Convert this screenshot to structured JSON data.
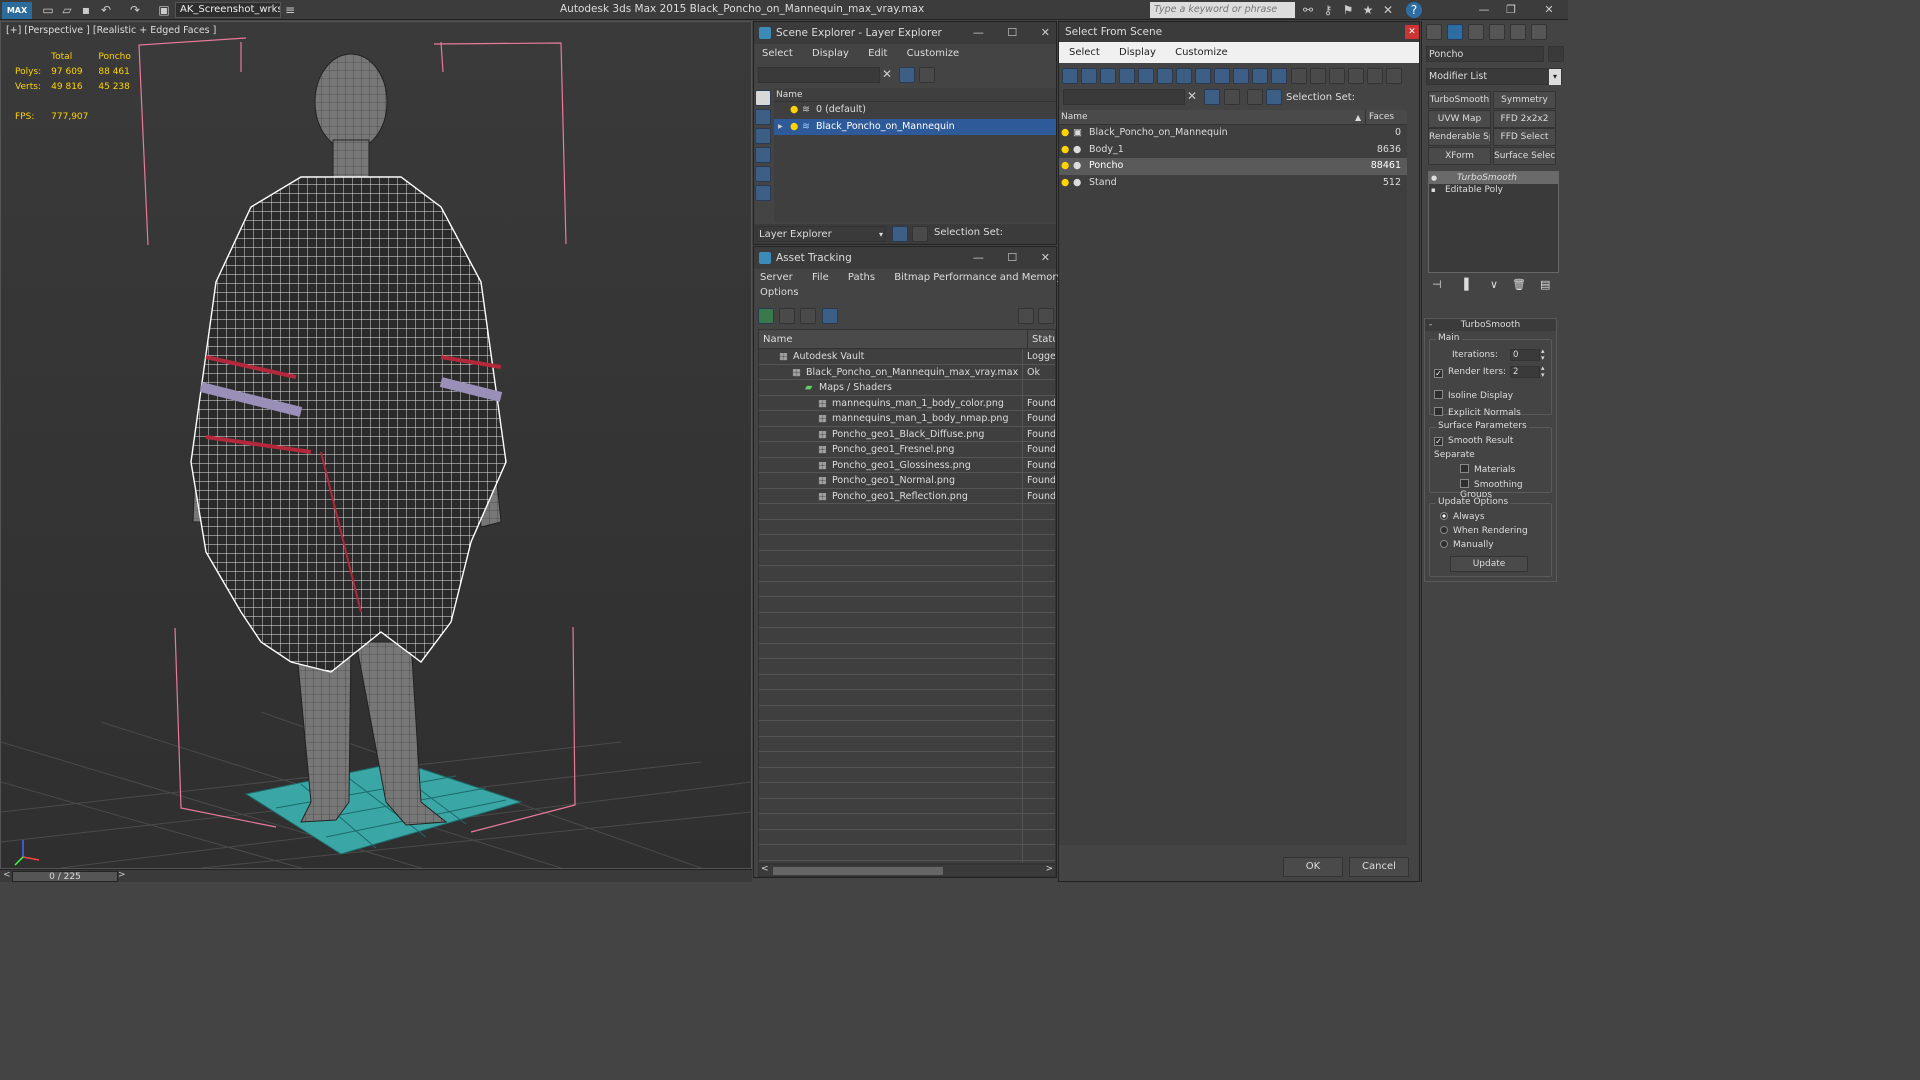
{
  "app": {
    "title": "Autodesk 3ds Max  2015    Black_Poncho_on_Mannequin_max_vray.max",
    "workspace": "AK_Screenshot_wrksp",
    "search_placeholder": "Type a keyword or phrase",
    "logo": "MAX"
  },
  "viewport": {
    "label": "[+] [Perspective ] [Realistic + Edged Faces ]",
    "stats": {
      "col_total": "Total",
      "col_sel": "Poncho",
      "polys_label": "Polys:",
      "polys_total": "97 609",
      "polys_sel": "88 461",
      "verts_label": "Verts:",
      "verts_total": "49 816",
      "verts_sel": "45 238",
      "fps_label": "FPS:",
      "fps_value": "777,907"
    }
  },
  "timeline": {
    "frame": "0 / 225"
  },
  "scene_explorer": {
    "title": "Scene Explorer - Layer Explorer",
    "menu": [
      "Select",
      "Display",
      "Edit",
      "Customize"
    ],
    "col_name": "Name",
    "rows": [
      "0 (default)",
      "Black_Poncho_on_Mannequin"
    ],
    "footer_label": "Layer Explorer",
    "selection_set": "Selection Set:"
  },
  "asset_tracking": {
    "title": "Asset Tracking",
    "menu": [
      "Server",
      "File",
      "Paths",
      "Bitmap Performance and Memory"
    ],
    "menu2": "Options",
    "col_name": "Name",
    "col_status": "Status",
    "rows": [
      {
        "name": "Autodesk Vault",
        "status": "Logged",
        "indent": 0
      },
      {
        "name": "Black_Poncho_on_Mannequin_max_vray.max",
        "status": "Ok",
        "indent": 1
      },
      {
        "name": "Maps / Shaders",
        "status": "",
        "indent": 2
      },
      {
        "name": "mannequins_man_1_body_color.png",
        "status": "Found",
        "indent": 3
      },
      {
        "name": "mannequins_man_1_body_nmap.png",
        "status": "Found",
        "indent": 3
      },
      {
        "name": "Poncho_geo1_Black_Diffuse.png",
        "status": "Found",
        "indent": 3
      },
      {
        "name": "Poncho_geo1_Fresnel.png",
        "status": "Found",
        "indent": 3
      },
      {
        "name": "Poncho_geo1_Glossiness.png",
        "status": "Found",
        "indent": 3
      },
      {
        "name": "Poncho_geo1_Normal.png",
        "status": "Found",
        "indent": 3
      },
      {
        "name": "Poncho_geo1_Reflection.png",
        "status": "Found",
        "indent": 3
      }
    ]
  },
  "select_from_scene": {
    "title": "Select From Scene",
    "menu": [
      "Select",
      "Display",
      "Customize"
    ],
    "selection_set": "Selection Set:",
    "col_name": "Name",
    "col_faces": "Faces",
    "rows": [
      {
        "name": "Black_Poncho_on_Mannequin",
        "faces": "0"
      },
      {
        "name": "Body_1",
        "faces": "8636"
      },
      {
        "name": "Poncho",
        "faces": "88461"
      },
      {
        "name": "Stand",
        "faces": "512"
      }
    ],
    "ok": "OK",
    "cancel": "Cancel"
  },
  "command_panel": {
    "object_name": "Poncho",
    "modifier_list": "Modifier List",
    "buttons": [
      "TurboSmooth",
      "Symmetry",
      "UVW Map",
      "FFD 2x2x2",
      "Renderable Spline",
      "FFD Select",
      "XForm",
      "Surface Select"
    ],
    "stack": [
      "TurboSmooth",
      "Editable Poly"
    ],
    "rollout_title": "TurboSmooth",
    "main_label": "Main",
    "iterations_label": "Iterations:",
    "iterations_value": "0",
    "render_iters_label": "Render Iters:",
    "render_iters_value": "2",
    "isoline": "Isoline Display",
    "explicit_normals": "Explicit Normals",
    "surface_params": "Surface Parameters",
    "smooth_result": "Smooth Result",
    "separate": "Separate",
    "materials": "Materials",
    "smoothing_groups": "Smoothing Groups",
    "update_options": "Update Options",
    "always": "Always",
    "when_rendering": "When Rendering",
    "manually": "Manually",
    "update_btn": "Update"
  }
}
